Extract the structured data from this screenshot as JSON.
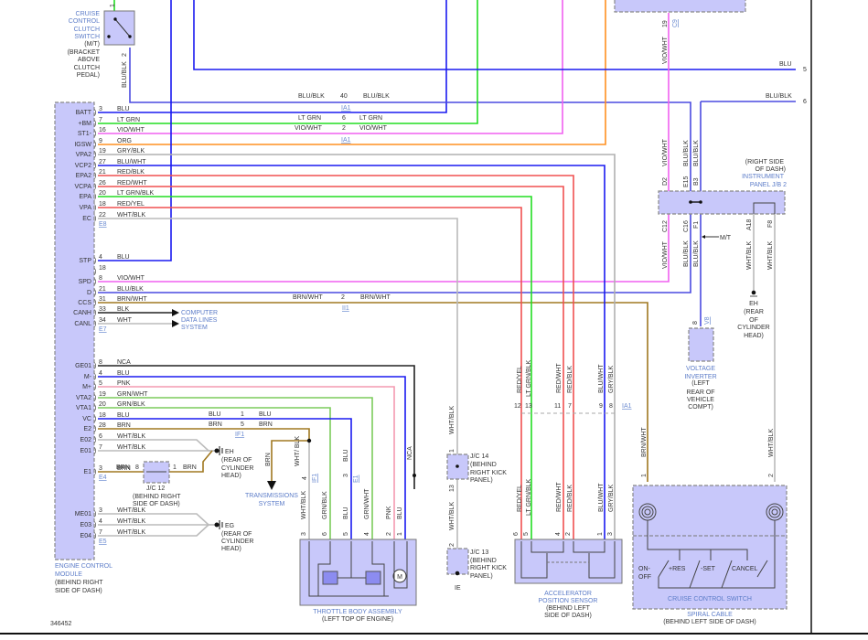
{
  "diagram_number": "346452",
  "wire_colors": {
    "BLU": "#1a1af0",
    "LT GRN": "#22dd22",
    "VIO/WHT": "#f060f0",
    "ORG": "#ff9020",
    "GRY/BLK": "#b0b0b0",
    "RED": "#f05050",
    "BRN": "#a07820",
    "NCA": "#222222",
    "PNK": "#f49ab0",
    "GRN": "#7ccc5c"
  },
  "ecm": {
    "name": [
      "ENGINE CONTROL",
      "MODULE"
    ],
    "location": [
      "(BEHIND RIGHT",
      "SIDE OF DASH)"
    ],
    "groups": [
      {
        "connector": "E8",
        "pins": [
          {
            "label": "BATT",
            "pin": "3",
            "wire": "BLU"
          },
          {
            "label": "+BM",
            "pin": "7",
            "wire": "LT GRN"
          },
          {
            "label": "ST1-",
            "pin": "16",
            "wire": "VIO/WHT"
          },
          {
            "label": "IGSW",
            "pin": "9",
            "wire": "ORG"
          },
          {
            "label": "VPA2",
            "pin": "19",
            "wire": "GRY/BLK"
          },
          {
            "label": "VCP2",
            "pin": "27",
            "wire": "BLU/WHT"
          },
          {
            "label": "EPA2",
            "pin": "21",
            "wire": "RED/BLK"
          },
          {
            "label": "VCPA",
            "pin": "26",
            "wire": "RED/WHT"
          },
          {
            "label": "EPA",
            "pin": "20",
            "wire": "LT GRN/BLK"
          },
          {
            "label": "VPA",
            "pin": "18",
            "wire": "RED/YEL"
          },
          {
            "label": "EC",
            "pin": "22",
            "wire": "WHT/BLK"
          }
        ]
      },
      {
        "connector": "E7",
        "pins": [
          {
            "label": "STP",
            "pin": "4",
            "wire": "BLU"
          },
          {
            "label": "",
            "pin": "18",
            "wire": ""
          },
          {
            "label": "SPD",
            "pin": "8",
            "wire": "VIO/WHT"
          },
          {
            "label": "D",
            "pin": "21",
            "wire": "BLU/BLK"
          },
          {
            "label": "CCS",
            "pin": "31",
            "wire": "BRN/WHT"
          },
          {
            "label": "CANH",
            "pin": "33",
            "wire": "BLK"
          },
          {
            "label": "CANL",
            "pin": "34",
            "wire": "WHT"
          }
        ]
      },
      {
        "connector": "E4",
        "pins": [
          {
            "label": "GE01",
            "pin": "8",
            "wire": "NCA"
          },
          {
            "label": "M-",
            "pin": "4",
            "wire": "BLU"
          },
          {
            "label": "M+",
            "pin": "5",
            "wire": "PNK"
          },
          {
            "label": "VTA2",
            "pin": "19",
            "wire": "GRN/WHT"
          },
          {
            "label": "VTA1",
            "pin": "20",
            "wire": "GRN/BLK"
          },
          {
            "label": "VC",
            "pin": "18",
            "wire": "BLU"
          },
          {
            "label": "E2",
            "pin": "28",
            "wire": "BRN"
          },
          {
            "label": "E02",
            "pin": "6",
            "wire": "WHT/BLK"
          },
          {
            "label": "E01",
            "pin": "7",
            "wire": "WHT/BLK"
          },
          {
            "label": "E1",
            "pin": "3",
            "wire": "BRN"
          }
        ]
      },
      {
        "connector": "E5",
        "pins": [
          {
            "label": "ME01",
            "pin": "3",
            "wire": "WHT/BLK"
          },
          {
            "label": "E03",
            "pin": "4",
            "wire": "WHT/BLK"
          },
          {
            "label": "E04",
            "pin": "7",
            "wire": "WHT/BLK"
          }
        ]
      }
    ]
  },
  "clutch_switch": {
    "name": [
      "CRUISE",
      "CONTROL",
      "CLUTCH",
      "SWITCH"
    ],
    "location": [
      "(M/T)",
      "(BRACKET",
      "ABOVE",
      "CLUTCH",
      "PEDAL)"
    ],
    "pin_top": "1",
    "pin_bottom": "2",
    "wire": "BLU/BLK"
  },
  "ia1_top": {
    "ref": "IA1",
    "rows": [
      {
        "left": "BLU/BLK",
        "pin": "40",
        "right": "BLU/BLK"
      },
      {
        "left": "LT GRN",
        "pin": "6",
        "right": "LT GRN"
      },
      {
        "left": "VIO/WHT",
        "pin": "2",
        "right": "VIO/WHT"
      }
    ]
  },
  "right_edge": [
    {
      "wire": "BLU",
      "ref": "5"
    },
    {
      "wire": "BLU/BLK",
      "ref": "6"
    }
  ],
  "top_connector": {
    "pin": "19",
    "ref": "C9",
    "wire": "VIO/WHT"
  },
  "junction_block": {
    "location": [
      "(RIGHT SIDE",
      "OF DASH)"
    ],
    "name": [
      "INSTRUMENT",
      "PANEL J/B 2"
    ],
    "top_pins": [
      {
        "pin": "D2",
        "wire": "VIO/WHT"
      },
      {
        "pin": "E15",
        "wire": "BLU/BLK"
      },
      {
        "pin": "B3",
        "wire": "BLU/BLK"
      }
    ],
    "bottom_pins": [
      {
        "pin": "C12",
        "wire": "VIO/WHT"
      },
      {
        "pin": "C16",
        "wire": "BLU/BLK"
      },
      {
        "pin": "F1",
        "wire": "BLU/BLK"
      },
      {
        "pin": "A18",
        "wire": "WHT/BLK"
      },
      {
        "pin": "F8",
        "wire": "WHT/BLK"
      }
    ],
    "mt_label": "M/T"
  },
  "ground_eh_right": {
    "name": "EH",
    "location": [
      "(REAR",
      "OF",
      "CYLINDER",
      "HEAD)"
    ]
  },
  "voltage_inverter": {
    "name": [
      "VOLTAGE",
      "INVERTER"
    ],
    "location": [
      "(LEFT",
      "REAR OF",
      "VEHICLE",
      "COMPT)"
    ],
    "pin": "8",
    "ref": "V8"
  },
  "ccs_connector": {
    "left": "BRN/WHT",
    "pin": "2",
    "right": "BRN/WHT",
    "ref": "II1"
  },
  "can_label": [
    "COMPUTER",
    "DATA LINES",
    "SYSTEM"
  ],
  "if1": {
    "ref": "IF1",
    "rows": [
      {
        "left": "BLU",
        "pin": "1",
        "right": "BLU"
      },
      {
        "left": "BRN",
        "pin": "5",
        "right": "BRN"
      }
    ]
  },
  "ground_eh_left": {
    "name": "EH",
    "location": [
      "(REAR OF",
      "CYLINDER",
      "HEAD)"
    ]
  },
  "ground_eg": {
    "name": "EG",
    "location": [
      "(REAR OF",
      "CYLINDER",
      "HEAD)"
    ]
  },
  "jc12": {
    "name": "J/C 12",
    "location": [
      "(BEHIND RIGHT",
      "SIDE OF DASH)"
    ],
    "pin_left": "8",
    "pin_right": "1",
    "wire_left": "BRN",
    "wire_right": "BRN"
  },
  "transmission": {
    "wire": "BRN",
    "name": [
      "TRANSMISSIONS",
      "SYSTEM"
    ]
  },
  "throttle": {
    "name": "THROTTLE BODY ASSEMBLY",
    "location": "(LEFT TOP OF ENGINE)",
    "upper": [
      {
        "wire": "WHT/ BLK",
        "pin": "4",
        "ref": "IF1"
      },
      {
        "wire": "BLU",
        "pin": "3",
        "ref": "E1"
      },
      {
        "wire": "NCA"
      }
    ],
    "pins": [
      {
        "pin": "3",
        "wire": "WHT/BLK"
      },
      {
        "pin": "6",
        "wire": "GRN/BLK"
      },
      {
        "pin": "5",
        "wire": "BLU"
      },
      {
        "pin": "4",
        "wire": "GRN/WHT"
      },
      {
        "pin": "2",
        "wire": "PNK"
      },
      {
        "pin": "1",
        "wire": "BLU"
      }
    ],
    "motor": "M"
  },
  "jc14": {
    "name": "J/C 14",
    "location": [
      "(BEHIND",
      "RIGHT KICK",
      "PANEL)"
    ],
    "pin_top": "1",
    "pin_bottom": "13",
    "wire_top": "WHT/BLK",
    "wire_bottom": "WHT/BLK"
  },
  "jc13": {
    "name": "J/C 13",
    "location": [
      "(BEHIND",
      "RIGHT KICK",
      "PANEL)"
    ],
    "pin_top": "2",
    "ground": "IE"
  },
  "ia1_aps": {
    "ref": "IA1",
    "pins": [
      {
        "pin": "12",
        "wire": "RED/YEL"
      },
      {
        "pin": "13",
        "wire": "LT GRN/BLK"
      },
      {
        "pin": "11",
        "wire": "RED/WHT"
      },
      {
        "pin": "7",
        "wire": "RED/BLK"
      },
      {
        "pin": "9",
        "wire": "BLU/WHT"
      },
      {
        "pin": "8",
        "wire": "GRY/BLK"
      }
    ]
  },
  "aps": {
    "name": [
      "ACCELERATOR",
      "POSITION SENSOR"
    ],
    "location": [
      "(BEHIND LEFT",
      "SIDE OF DASH)"
    ],
    "pins": [
      {
        "pin": "6",
        "wire": "RED/YEL"
      },
      {
        "pin": "5",
        "wire": "LT GRN/BLK"
      },
      {
        "pin": "4",
        "wire": "RED/WHT"
      },
      {
        "pin": "2",
        "wire": "RED/BLK"
      },
      {
        "pin": "1",
        "wire": "BLU/WHT"
      },
      {
        "pin": "3",
        "wire": "GRY/BLK"
      }
    ]
  },
  "cruise": {
    "name": "CRUISE CONTROL SWITCH",
    "spiral": "SPIRAL CABLE",
    "location": "(BEHIND LEFT SIDE OF DASH)",
    "pin_left": "1",
    "pin_right": "2",
    "wire_left": "BRN/WHT",
    "wire_right": "WHT/BLK",
    "switches": [
      "ON-",
      "OFF",
      "+RES",
      "-SET",
      "CANCEL"
    ]
  }
}
